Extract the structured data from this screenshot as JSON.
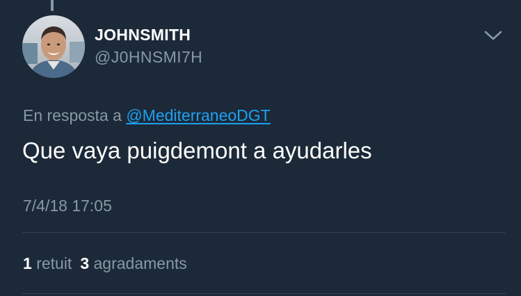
{
  "tweet": {
    "display_name": "JOHNSMITH",
    "handle": "@J0HNSMI7H",
    "reply_prefix": "En resposta a",
    "reply_mention": "@MediterraneoDGT",
    "text": "Que vaya puigdemont a ayudarles",
    "timestamp": "7/4/18 17:05"
  },
  "stats": {
    "retweets_count": "1",
    "retweets_label": "retuit",
    "likes_count": "3",
    "likes_label": "agradaments"
  },
  "icons": {
    "menu": "chevron-down-icon"
  },
  "colors": {
    "background": "#1c2938",
    "secondary_text": "#8899a6",
    "link": "#1da1f2",
    "divider": "#38444d"
  }
}
